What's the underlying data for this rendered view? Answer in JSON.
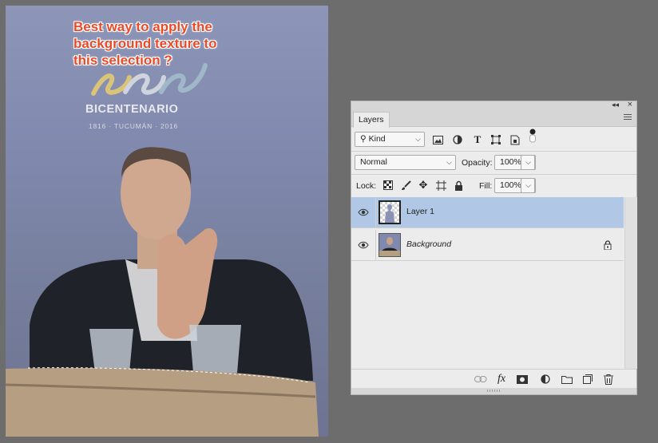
{
  "annotation": {
    "lines": [
      "Best way to apply the",
      "background texture to",
      "this selection ?"
    ]
  },
  "poster": {
    "number": "200",
    "title": "BICENTENARIO",
    "subtitle": "1816 · TUCUMÁN · 2016"
  },
  "colors": {
    "annotation_text": "#e84a2a",
    "panel_bg": "#ececec",
    "selected_row": "#b0c8e6",
    "app_bg": "#6d6d6d"
  },
  "panel": {
    "tab_label": "Layers",
    "filter": {
      "label": "Kind",
      "icons": [
        "image-filter-icon",
        "adjustment-filter-icon",
        "type-filter-icon",
        "shape-filter-icon",
        "smart-object-filter-icon"
      ]
    },
    "blend_mode": "Normal",
    "opacity_label": "Opacity:",
    "opacity_value": "100%",
    "lock_label": "Lock:",
    "fill_label": "Fill:",
    "fill_value": "100%",
    "layers": [
      {
        "name": "Layer 1",
        "visible": true,
        "selected": true,
        "locked": false
      },
      {
        "name": "Background",
        "visible": true,
        "selected": false,
        "locked": true
      }
    ],
    "footer_icons": [
      "link-icon",
      "fx-icon",
      "mask-icon",
      "adjustment-icon",
      "folder-icon",
      "new-layer-icon",
      "trash-icon"
    ],
    "fx_label": "fx"
  }
}
